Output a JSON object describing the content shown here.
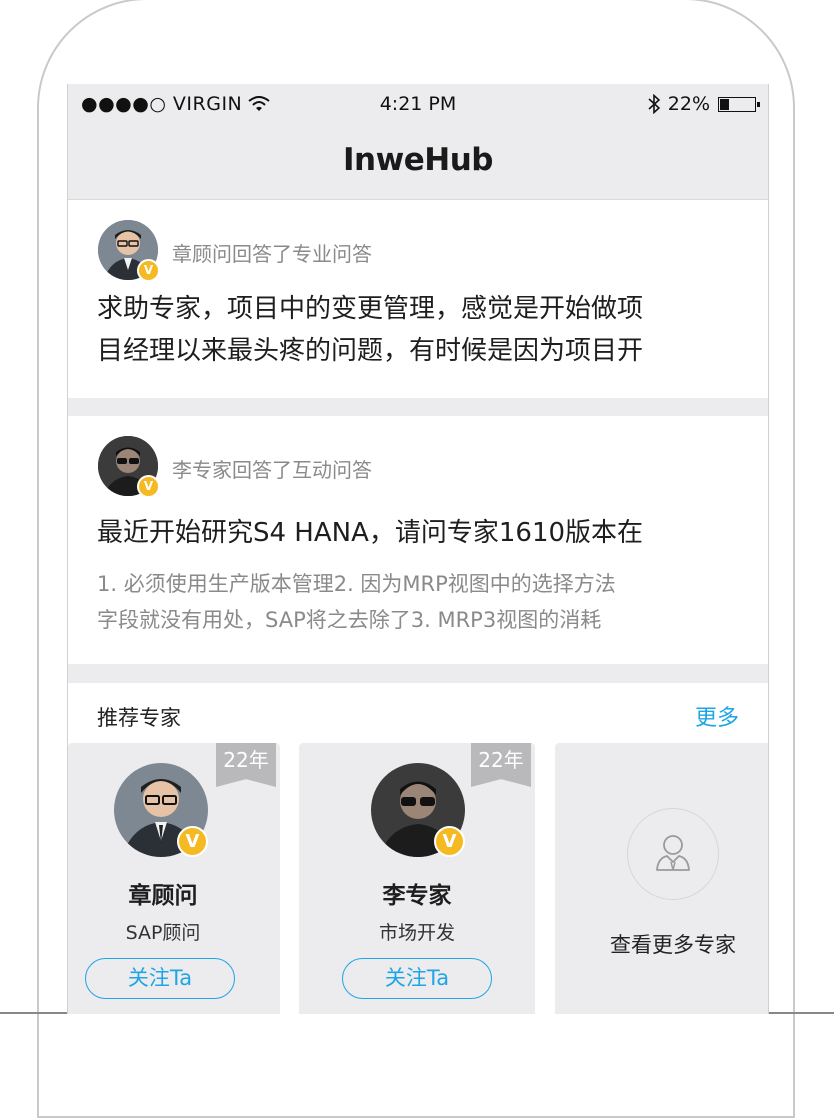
{
  "status_bar": {
    "carrier": "●●●●○ VIRGIN",
    "time": "4:21 PM",
    "battery_pct": "22%"
  },
  "nav": {
    "title": "InweHub"
  },
  "feed": [
    {
      "meta": "章顾问回答了专业问答",
      "title_line1": "求助专家，项目中的变更管理，感觉是开始做项",
      "title_line2": "目经理以来最头疼的问题，有时候是因为项目开"
    },
    {
      "meta": "李专家回答了互动问答",
      "title": "最近开始研究S4 HANA，请问专家1610版本在",
      "body_line1": "1. 必须使用生产版本管理2. 因为MRP视图中的选择方法",
      "body_line2": "字段就没有用处，SAP将之去除了3. MRP3视图的消耗"
    }
  ],
  "recommend": {
    "title": "推荐专家",
    "more": "更多",
    "experts": [
      {
        "years": "22年",
        "badge": "V",
        "name": "章顾问",
        "role": "SAP顾问",
        "follow": "关注Ta"
      },
      {
        "years": "22年",
        "badge": "V",
        "name": "李专家",
        "role": "市场开发",
        "follow": "关注Ta"
      }
    ],
    "view_more": "查看更多专家"
  },
  "colors": {
    "accent": "#1ea5e6",
    "badge": "#f5b922",
    "tag": "#b9b9bb"
  }
}
